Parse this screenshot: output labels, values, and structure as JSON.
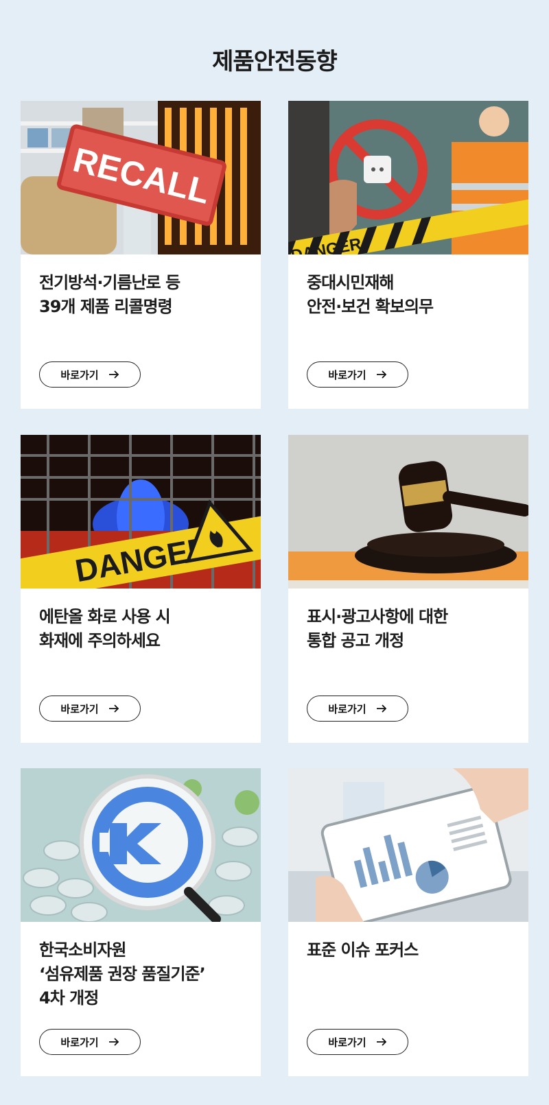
{
  "page": {
    "title": "제품안전동향"
  },
  "cards": [
    {
      "title": "전기방석·기름난로 등\n39개 제품 리콜명령",
      "button_label": "바로가기",
      "image_text": "RECALL"
    },
    {
      "title": "중대시민재해\n안전·보건 확보의무",
      "button_label": "바로가기",
      "image_text": "DANGER"
    },
    {
      "title": "에탄올 화로 사용 시\n화재에 주의하세요",
      "button_label": "바로가기",
      "image_text": "DANGER"
    },
    {
      "title": "표시·광고사항에 대한\n통합 공고 개정",
      "button_label": "바로가기"
    },
    {
      "title": "한국소비자원\n‘섬유제품 권장 품질기준’\n4차 개정",
      "button_label": "바로가기"
    },
    {
      "title": "표준 이슈 포커스",
      "button_label": "바로가기"
    }
  ],
  "colors": {
    "background": "#e4eef6",
    "card": "#ffffff",
    "text": "#1b1b1b",
    "recall_red": "#d9403a",
    "danger_yellow": "#f2cf1f",
    "kg_blue": "#4a86e0"
  }
}
